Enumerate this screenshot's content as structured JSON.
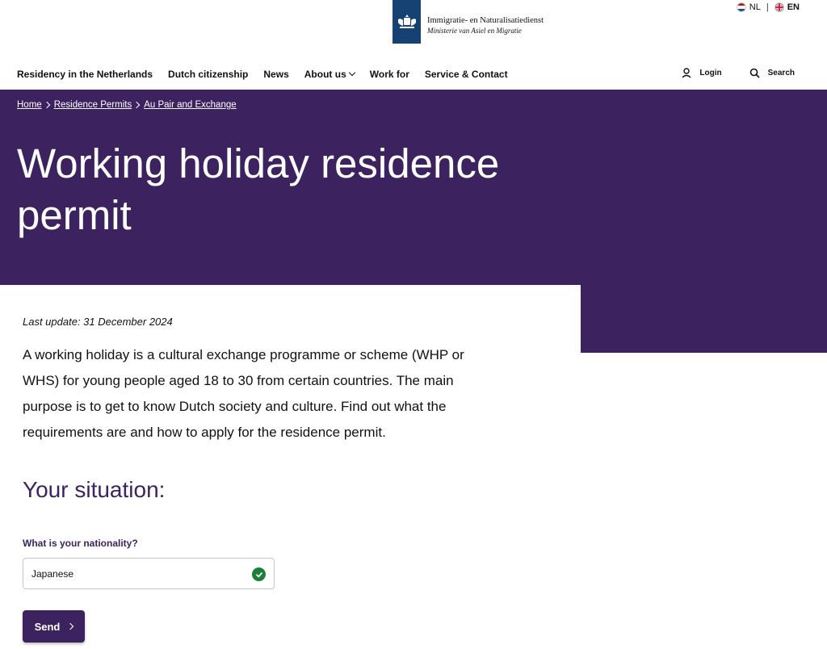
{
  "brand": {
    "line1": "Immigratie- en Naturalisatiedienst",
    "line2": "Ministerie van Asiel en Migratie",
    "color": "#154273"
  },
  "language": {
    "nl": "NL",
    "en": "EN",
    "separator": "|"
  },
  "nav": {
    "items": [
      {
        "label": "Residency in the Netherlands"
      },
      {
        "label": "Dutch citizenship"
      },
      {
        "label": "News"
      },
      {
        "label": "About us"
      },
      {
        "label": "Work for"
      },
      {
        "label": "Service & Contact"
      }
    ],
    "login": "Login",
    "search": "Search"
  },
  "breadcrumb": {
    "items": [
      "Home",
      "Residence Permits",
      "Au Pair and Exchange"
    ]
  },
  "hero": {
    "title": "Working holiday residence permit",
    "color": "#3c2360"
  },
  "content": {
    "last_update": "Last update: 31 December 2024",
    "intro": "A working holiday is a cultural exchange programme or scheme (WHP or WHS) for young people aged 18 to 30 from certain countries. The main purpose is to get to know Dutch society and culture. Find out what the requirements are and how to apply for the residence permit."
  },
  "form": {
    "heading": "Your situation:",
    "nationality_label": "What is your nationality?",
    "nationality_value": "Japanese",
    "send_label": "Send",
    "valid_color": "#1a7f37"
  }
}
